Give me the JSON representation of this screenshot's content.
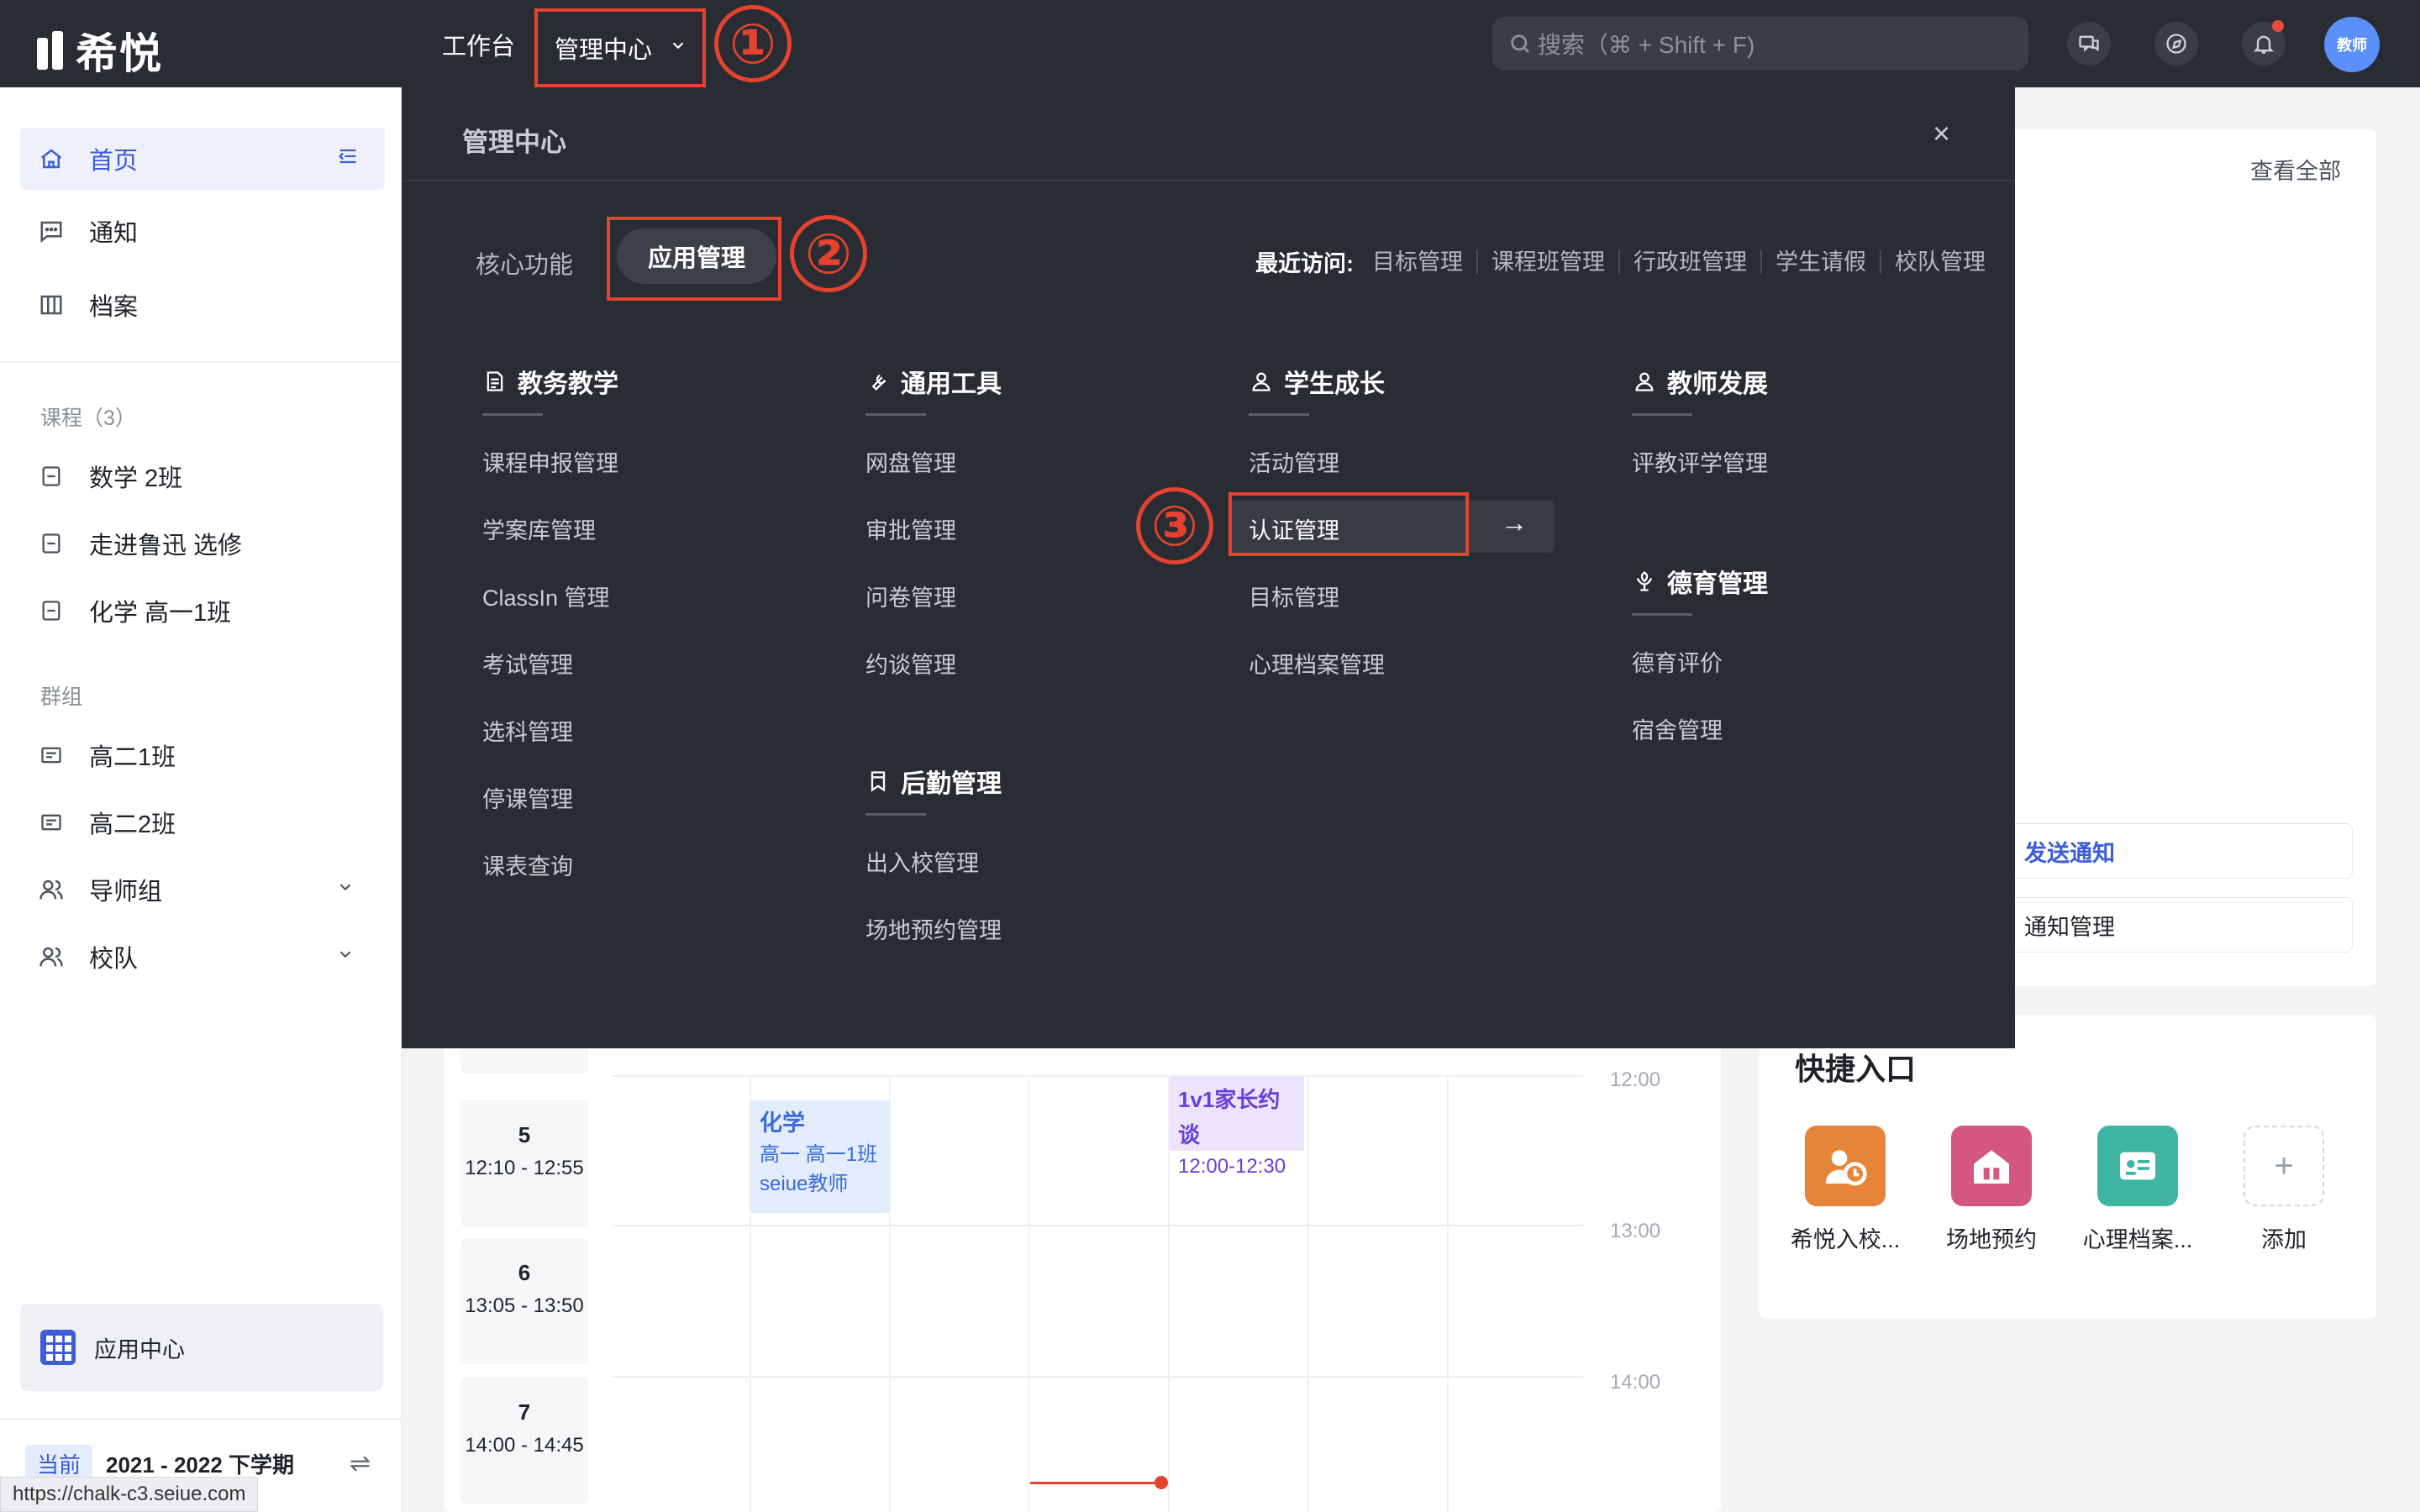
{
  "topbar": {
    "logo_text": "希悦",
    "nav_work": "工作台",
    "nav_admin": "管理中心",
    "search_placeholder": "搜索（⌘ + Shift + F)",
    "avatar_label": "教师"
  },
  "annotations": {
    "a1": "①",
    "a2": "②",
    "a3": "③"
  },
  "sidebar": {
    "home": "首页",
    "notice": "通知",
    "archive": "档案",
    "courses_head": "课程（3）",
    "courses": [
      "数学 2班",
      "走进鲁迅 选修",
      "化学 高一1班"
    ],
    "groups_head": "群组",
    "groups": [
      "高二1班",
      "高二2班",
      "导师组",
      "校队"
    ],
    "app_center": "应用中心",
    "term_current": "当前",
    "term_label": "2021 - 2022 下学期"
  },
  "status_url": "https://chalk-c3.seiue.com",
  "panel": {
    "title": "管理中心",
    "tab_core": "核心功能",
    "tab_app": "应用管理",
    "recent_label": "最近访问:",
    "recent_links": [
      "目标管理",
      "课程班管理",
      "行政班管理",
      "学生请假",
      "校队管理"
    ],
    "categories": {
      "teaching": {
        "title": "教务教学",
        "items": [
          "课程申报管理",
          "学案库管理",
          "ClassIn 管理",
          "考试管理",
          "选科管理",
          "停课管理",
          "课表查询"
        ]
      },
      "tools": {
        "title": "通用工具",
        "items": [
          "网盘管理",
          "审批管理",
          "问卷管理",
          "约谈管理"
        ]
      },
      "logistics": {
        "title": "后勤管理",
        "items": [
          "出入校管理",
          "场地预约管理"
        ]
      },
      "growth": {
        "title": "学生成长",
        "items": [
          "活动管理",
          "认证管理",
          "目标管理",
          "心理档案管理"
        ]
      },
      "teacher": {
        "title": "教师发展",
        "items": [
          "评教评学管理"
        ]
      },
      "moral": {
        "title": "德育管理",
        "items": [
          "德育评价",
          "宿舍管理"
        ]
      }
    }
  },
  "right": {
    "view_all": "查看全部",
    "send_notice": "发送通知",
    "notice_manage": "通知管理",
    "quick_title": "快捷入口",
    "quick_items": [
      "希悦入校...",
      "场地预约",
      "心理档案...",
      "添加"
    ]
  },
  "timetable": {
    "rows": [
      {
        "n": "5",
        "t": "12:10 - 12:55"
      },
      {
        "n": "6",
        "t": "13:05 - 13:50"
      },
      {
        "n": "7",
        "t": "14:00 - 14:45"
      }
    ],
    "times": [
      "12:00",
      "13:00",
      "14:00"
    ],
    "event_chem": {
      "title": "化学",
      "line1": "高一  高一1班",
      "line2": "seiue教师"
    },
    "event_parent": {
      "title": "1v1家长约谈",
      "time": "12:00-12:30"
    }
  },
  "colors": {
    "accent": "#3c5cd8",
    "annotation": "#e5432f",
    "topbar": "#2a2c33"
  }
}
